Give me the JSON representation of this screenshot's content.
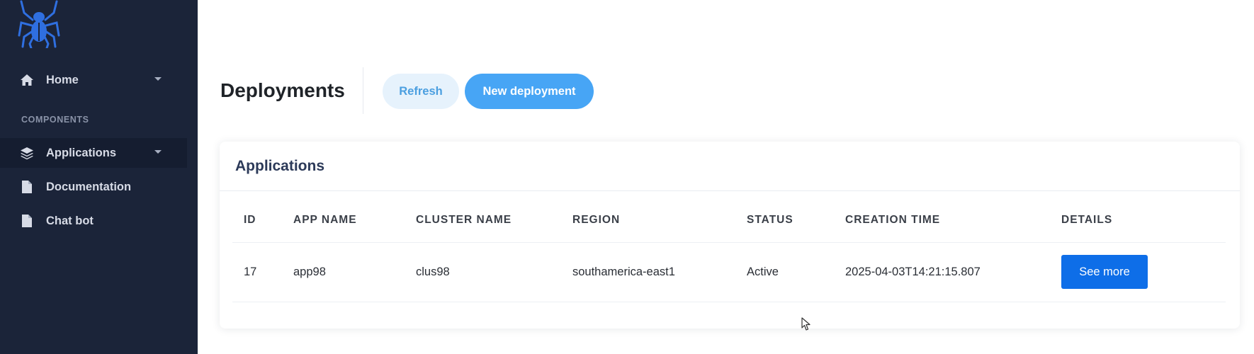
{
  "sidebar": {
    "logo_icon": "spider-icon",
    "items": [
      {
        "label": "Home",
        "icon": "home-icon",
        "has_caret": true
      },
      {
        "label": "Applications",
        "icon": "layers-icon",
        "has_caret": true,
        "active": true
      },
      {
        "label": "Documentation",
        "icon": "file-icon",
        "has_caret": false
      },
      {
        "label": "Chat bot",
        "icon": "file-icon",
        "has_caret": false
      }
    ],
    "section_label": "COMPONENTS"
  },
  "header": {
    "title": "Deployments",
    "refresh_label": "Refresh",
    "new_deployment_label": "New deployment"
  },
  "card": {
    "title": "Applications",
    "columns": [
      "ID",
      "APP NAME",
      "CLUSTER NAME",
      "REGION",
      "STATUS",
      "CREATION TIME",
      "DETAILS"
    ],
    "rows": [
      {
        "id": "17",
        "app_name": "app98",
        "cluster_name": "clus98",
        "region": "southamerica-east1",
        "status": "Active",
        "creation_time": "2025-04-03T14:21:15.807",
        "details_label": "See more"
      }
    ]
  },
  "colors": {
    "sidebar_bg": "#1b2439",
    "accent": "#47a5f5",
    "primary_button": "#0e6ee8",
    "logo": "#2f6fe0"
  }
}
